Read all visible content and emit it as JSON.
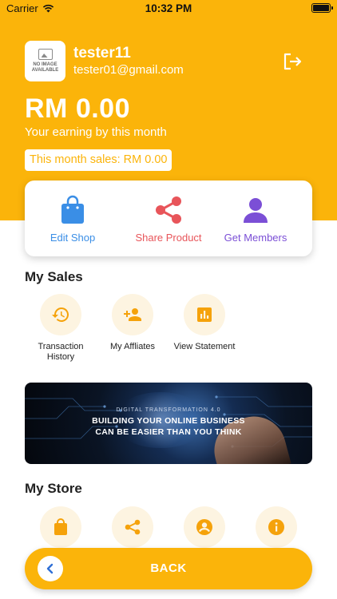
{
  "status_bar": {
    "carrier": "Carrier",
    "time": "10:32 PM"
  },
  "profile": {
    "avatar_text": "NO IMAGE AVAILABLE",
    "username": "tester11",
    "email": "tester01@gmail.com"
  },
  "earnings": {
    "amount": "RM 0.00",
    "caption": "Your earning by this month",
    "sales_badge": "This month sales: RM 0.00"
  },
  "actions": [
    {
      "label": "Edit Shop",
      "color": "#3a8ee6",
      "icon": "shopping-bag-icon"
    },
    {
      "label": "Share Product",
      "color": "#e8555a",
      "icon": "share-icon"
    },
    {
      "label": "Get Members",
      "color": "#7b4fd6",
      "icon": "person-icon"
    }
  ],
  "my_sales": {
    "title": "My Sales",
    "items": [
      {
        "label": "Transaction History",
        "icon": "history-icon"
      },
      {
        "label": "My Affliates",
        "icon": "add-person-icon"
      },
      {
        "label": "View Statement",
        "icon": "statement-icon"
      }
    ]
  },
  "banner": {
    "subtitle": "DIGITAL TRANSFORMATION 4.0",
    "headline_line1": "BUILDING YOUR ONLINE BUSINESS",
    "headline_line2": "CAN BE EASIER THAN YOU THINK"
  },
  "my_store": {
    "title": "My Store",
    "items": [
      {
        "icon": "shopping-bag-icon"
      },
      {
        "icon": "share-icon"
      },
      {
        "icon": "account-icon"
      },
      {
        "icon": "info-icon"
      }
    ]
  },
  "back_button": {
    "label": "BACK"
  },
  "colors": {
    "brand": "#fbb40a",
    "icon_tint": "#f5a20b",
    "circle_bg": "#fdf4e1"
  }
}
